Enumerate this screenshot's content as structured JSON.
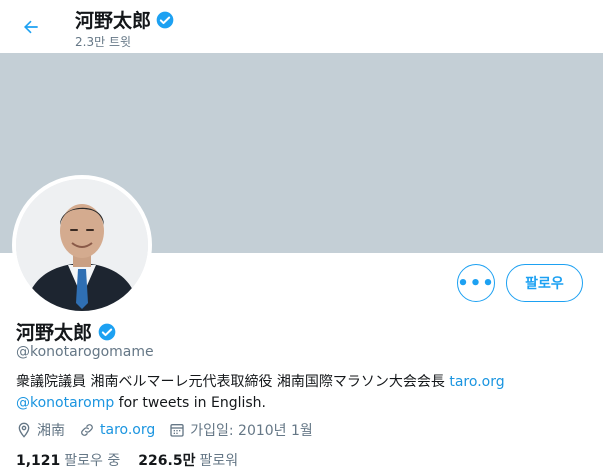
{
  "header": {
    "name": "河野太郎",
    "tweet_count": "2.3만 트윗"
  },
  "profile": {
    "name": "河野太郎",
    "handle": "@konotarogomame",
    "bio_text": "衆議院議員 湘南ベルマーレ元代表取締役 湘南国際マラソン大会会長 ",
    "bio_link": "taro.org",
    "bio_mention": "@konotaromp",
    "bio_suffix": " for tweets in English.",
    "location": "湘南",
    "website": "taro.org",
    "joined": "가입일: 2010년 1월"
  },
  "actions": {
    "more_label": "•••",
    "follow_label": "팔로우"
  },
  "stats": {
    "following_count": "1,121",
    "following_label": "팔로우 중",
    "followers_count": "226.5만",
    "followers_label": "팔로워"
  },
  "colors": {
    "accent": "#1da1f2",
    "banner": "#c4cfd6",
    "secondary_text": "#657786"
  },
  "icons": {
    "back": "arrow-left-icon",
    "verified": "verified-badge-icon",
    "location": "location-pin-icon",
    "link": "link-icon",
    "calendar": "calendar-icon"
  }
}
